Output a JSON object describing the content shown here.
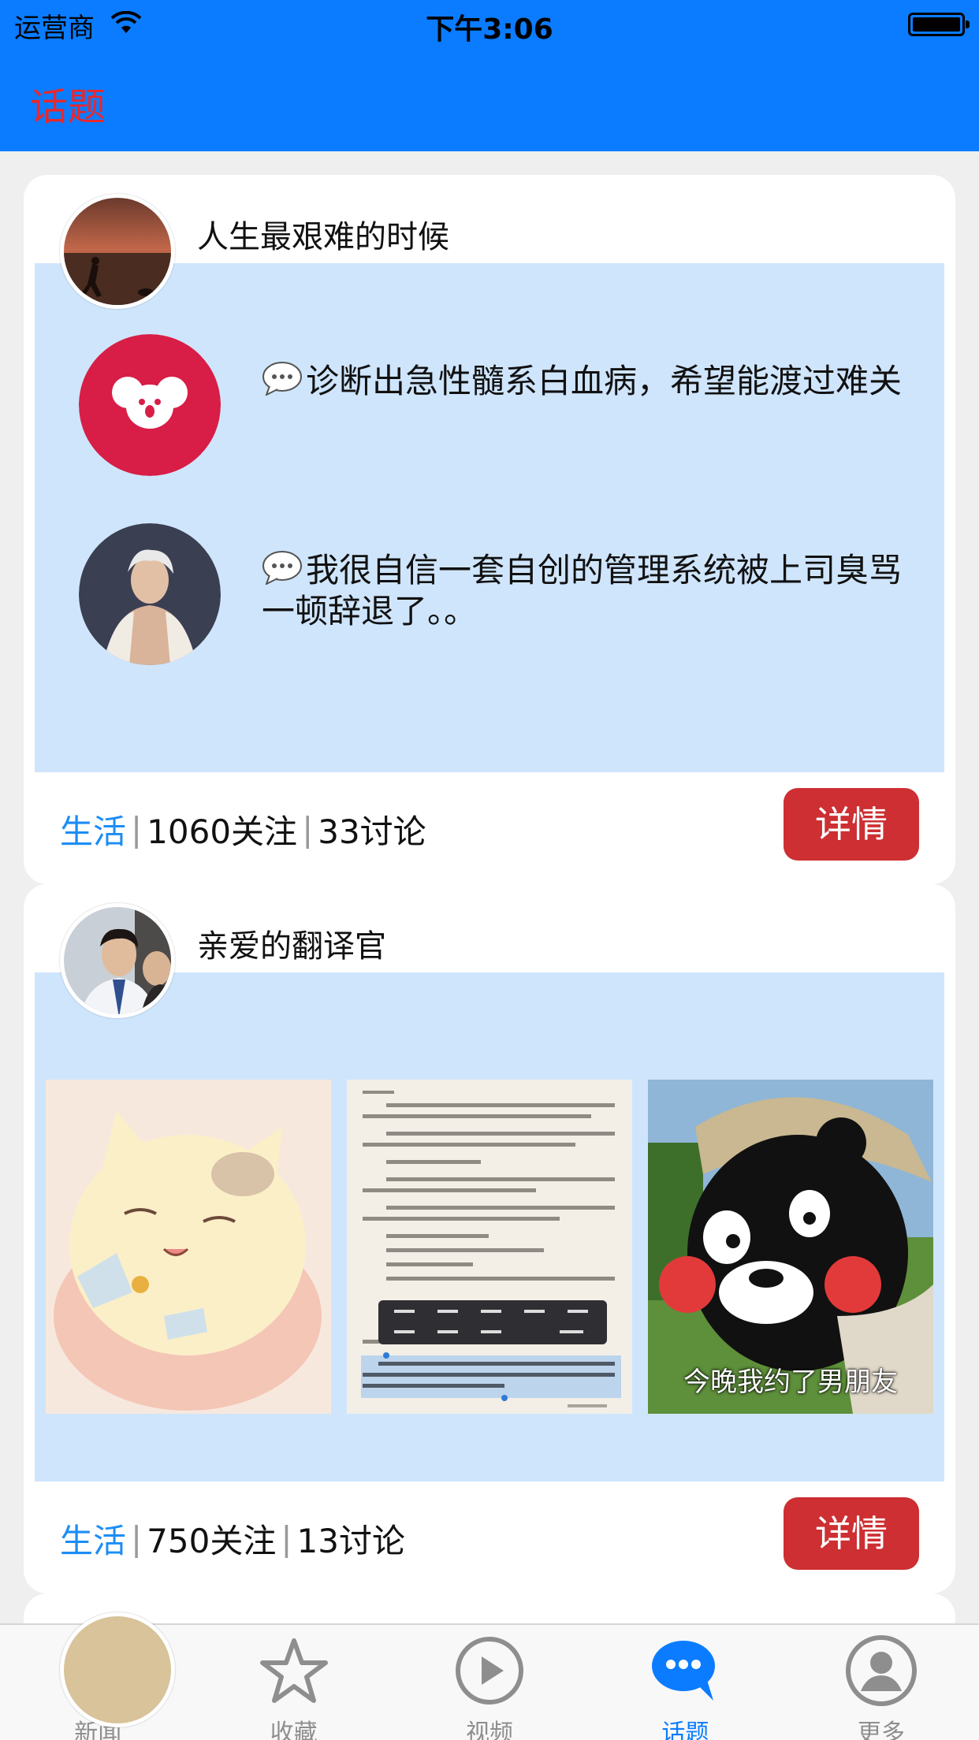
{
  "status_bar": {
    "carrier": "运营商",
    "time": "下午3:06"
  },
  "nav": {
    "title": "话题"
  },
  "topics": [
    {
      "title": "人生最艰难的时候",
      "comments": [
        {
          "text": "诊断出急性髓系白血病，希望能渡过难关"
        },
        {
          "text": "我很自信一套自创的管理系统被上司臭骂一顿辞退了。。"
        }
      ],
      "category": "生活",
      "follows": "1060关注",
      "discussions": "33讨论",
      "detail_label": "详情"
    },
    {
      "title": "亲爱的翻译官",
      "images": [
        {
          "icon": "cat-illustration"
        },
        {
          "icon": "reader-screenshot"
        },
        {
          "icon": "kumamon-photo",
          "caption": "今晚我约了男朋友"
        }
      ],
      "category": "生活",
      "follows": "750关注",
      "discussions": "13讨论",
      "detail_label": "详情"
    }
  ],
  "tabbar": {
    "items": [
      {
        "label": "新闻",
        "icon": "newspaper-icon",
        "active": false
      },
      {
        "label": "收藏",
        "icon": "star-icon",
        "active": false
      },
      {
        "label": "视频",
        "icon": "play-icon",
        "active": false
      },
      {
        "label": "话题",
        "icon": "chat-bubble-icon",
        "active": true
      },
      {
        "label": "更多",
        "icon": "user-icon",
        "active": false
      }
    ]
  },
  "colors": {
    "nav_bar": "#0b7cff",
    "title_red": "#e8282c",
    "card_body": "#cfe5fc",
    "detail_button": "#cd2f32",
    "category": "#1c8df5",
    "tab_active": "#0b7cff"
  }
}
